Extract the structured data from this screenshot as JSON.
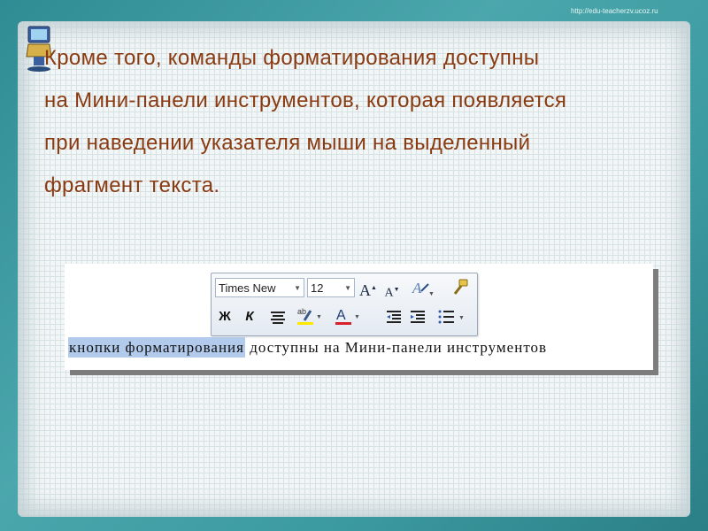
{
  "header": {
    "url": "http://edu-teacherzv.ucoz.ru"
  },
  "slide": {
    "lines": [
      "Кроме того, команды форматирования доступны",
      "на Мини-панели инструментов, которая появляется",
      "при наведении указателя мыши на выделенный",
      "фрагмент текста."
    ]
  },
  "toolbar": {
    "font_name": "Times New",
    "font_size": "12",
    "bold_label": "Ж",
    "italic_label": "К",
    "grow_font_label": "A",
    "shrink_font_label": "A",
    "highlight_label": "ab",
    "font_color_label": "A",
    "highlight_color": "#ffe800",
    "font_color": "#d8202a",
    "icons": [
      "grow-font-icon",
      "shrink-font-icon",
      "styles-icon",
      "format-painter-icon",
      "bold-icon",
      "italic-icon",
      "center-align-icon",
      "highlight-icon",
      "font-color-icon",
      "decrease-indent-icon",
      "increase-indent-icon",
      "bullets-icon"
    ]
  },
  "document": {
    "selected_text": "кнопки форматирования",
    "rest_text": " доступны на Мини-панели инструментов"
  }
}
